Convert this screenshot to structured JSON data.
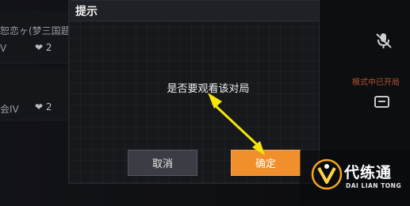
{
  "background": {
    "row1_name": "恕恋ヶ(梦三国题",
    "row1_rank": "V",
    "row1_likes": "2",
    "row2_rank": "会IV",
    "row2_likes": "2",
    "mode_text": "模式中已开局"
  },
  "dialog": {
    "title": "提示",
    "message": "是否要观看该对局",
    "cancel_label": "取消",
    "confirm_label": "确定"
  },
  "watermark": {
    "main": "代练通",
    "sub": "DAI LIAN TONG"
  },
  "colors": {
    "accent": "#f08f2b",
    "arrow": "#f5e60a",
    "dialog_bg": "#17181c"
  }
}
